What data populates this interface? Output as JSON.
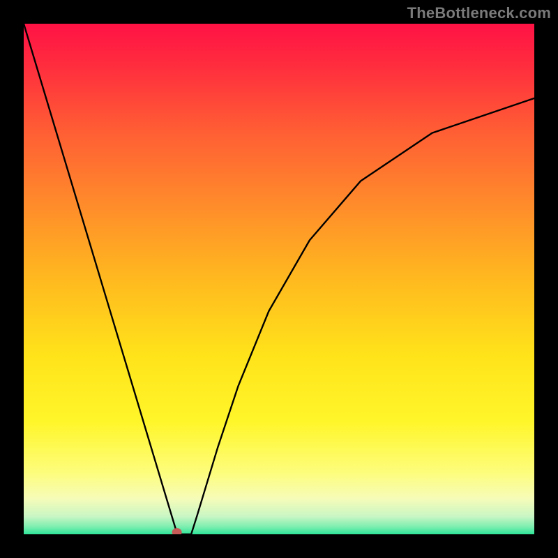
{
  "watermark": "TheBottleneck.com",
  "chart_data": {
    "type": "line",
    "title": "",
    "xlabel": "",
    "ylabel": "",
    "xlim": [
      0,
      100
    ],
    "ylim": [
      0,
      100
    ],
    "grid": false,
    "series": [
      {
        "name": "curve",
        "x": [
          0.0,
          4.0,
          8.0,
          12.0,
          16.0,
          20.0,
          24.0,
          28.0,
          29.9,
          30.1,
          32.8,
          34.0,
          38.0,
          42.0,
          48.0,
          56.0,
          66.0,
          80.0,
          100.0
        ],
        "y": [
          100.0,
          86.7,
          73.4,
          60.1,
          46.8,
          33.5,
          20.2,
          6.9,
          0.6,
          0.0,
          0.0,
          3.8,
          17.0,
          29.0,
          43.7,
          57.6,
          69.2,
          78.6,
          85.4
        ]
      }
    ],
    "marker": {
      "x": 30.0,
      "y": 0.4,
      "color": "#c65b58",
      "radius_px": 7
    },
    "background_gradient": {
      "stops": [
        {
          "offset": 0.0,
          "color": "#ff1245"
        },
        {
          "offset": 0.08,
          "color": "#ff2c3e"
        },
        {
          "offset": 0.2,
          "color": "#ff5a35"
        },
        {
          "offset": 0.35,
          "color": "#ff8a2b"
        },
        {
          "offset": 0.5,
          "color": "#ffb91f"
        },
        {
          "offset": 0.65,
          "color": "#ffe31a"
        },
        {
          "offset": 0.78,
          "color": "#fff62a"
        },
        {
          "offset": 0.88,
          "color": "#fdfd7d"
        },
        {
          "offset": 0.93,
          "color": "#f6fcb8"
        },
        {
          "offset": 0.965,
          "color": "#c9f6c4"
        },
        {
          "offset": 0.985,
          "color": "#7eeeb0"
        },
        {
          "offset": 1.0,
          "color": "#2de598"
        }
      ]
    }
  }
}
